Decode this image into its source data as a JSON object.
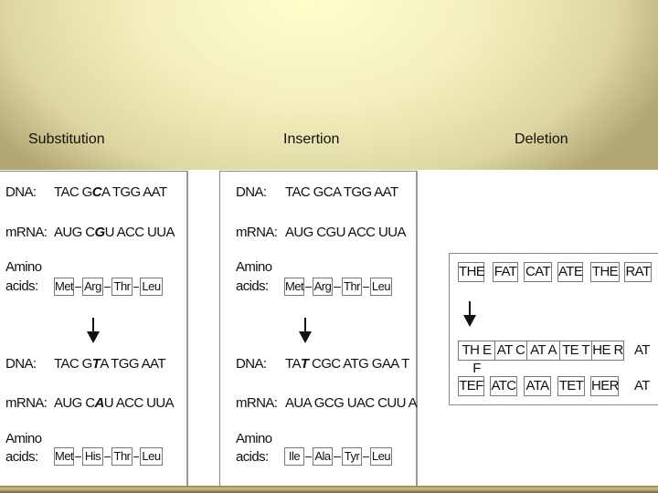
{
  "titles": {
    "substitution": "Substitution",
    "insertion": "Insertion",
    "deletion": "Deletion"
  },
  "labels": {
    "dna": "DNA:",
    "mrna": "mRNA:",
    "amino": "Amino",
    "acids": "acids:"
  },
  "substitution": {
    "dna_before": {
      "pre": "TAC G",
      "mut": "C",
      "post": "A TGG AAT"
    },
    "mrna_before": {
      "pre": "AUG C",
      "mut": "G",
      "post": "U ACC UUA"
    },
    "amino_before": [
      "Met",
      "Arg",
      "Thr",
      "Leu"
    ],
    "dna_after": {
      "pre": "TAC G",
      "mut": "T",
      "post": "A TGG AAT"
    },
    "mrna_after": {
      "pre": "AUG C",
      "mut": "A",
      "post": "U ACC UUA"
    },
    "amino_after": [
      "Met",
      "His",
      "Thr",
      "Leu"
    ]
  },
  "insertion": {
    "dna_before": "TAC GCA TGG AAT",
    "mrna_before": "AUG CGU ACC UUA",
    "amino_before": [
      "Met",
      "Arg",
      "Thr",
      "Leu"
    ],
    "dna_after": {
      "pre": "TA",
      "mut": "T",
      "post": " CGC ATG GAA T"
    },
    "mrna_after": "AUA GCG UAC CUU A",
    "amino_after": [
      "Ile",
      "Ala",
      "Tyr",
      "Leu"
    ]
  },
  "deletion": {
    "original": [
      "THE",
      "FAT",
      "CAT",
      "ATE",
      "THE",
      "RAT"
    ],
    "shifted": [
      "TH E F",
      "AT C",
      "AT A",
      "TE T",
      "HE R"
    ],
    "shifted_tail": "AT",
    "result": [
      "TEF",
      "ATC",
      "ATA",
      "TET",
      "HER"
    ],
    "result_tail": "AT"
  },
  "icons": {
    "arrow": "down-arrow-icon",
    "cross": "x-mark-icon"
  }
}
